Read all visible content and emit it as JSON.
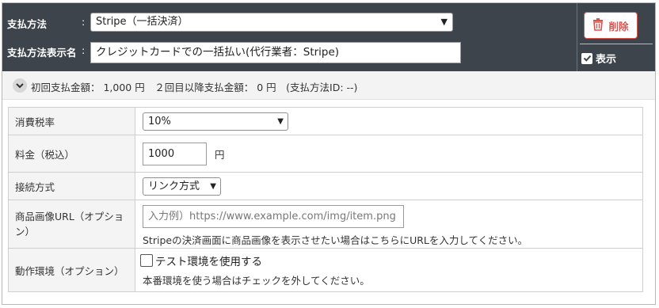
{
  "header": {
    "method_label": "支払方法",
    "method_colon": ":",
    "method_value": "Stripe（一括決済）",
    "display_name_label": "支払方法表示名",
    "display_name_colon": ":",
    "display_name_value": "クレジットカードでの一括払い(代行業者：Stripe)",
    "delete_label": "削除",
    "show_label": "表示",
    "show_checked": true
  },
  "summary": {
    "text": "初回支払金額： 1,000 円　２回目以降支払金額： 0 円　(支払方法ID: --)"
  },
  "rows": {
    "tax": {
      "label": "消費税率",
      "value": "10%"
    },
    "price": {
      "label": "料金（税込）",
      "value": "1000",
      "unit": "円"
    },
    "connect": {
      "label": "接続方式",
      "value": "リンク方式"
    },
    "image_url": {
      "label_line1": "商品画像URL（オプショ",
      "label_line2": "ン）",
      "placeholder": "入力例）https://www.example.com/img/item.png",
      "help": "Stripeの決済画面に商品画像を表示させたい場合はこちらにURLを入力してください。"
    },
    "env": {
      "label": "動作環境（オプション）",
      "checkbox_label": "テスト環境を使用する",
      "checked": false,
      "help": "本番環境を使う場合はチェックを外してください。"
    }
  },
  "colors": {
    "header_bg": "#3d444c",
    "delete_red": "#d9534f",
    "row_label_bg": "#f4f4f4",
    "summary_bg": "#f3f3f3"
  },
  "icons": {
    "delete": "trash-icon",
    "show_check": "check-icon",
    "toggle": "chevron-down-icon",
    "select": "chevron-down-icon"
  }
}
